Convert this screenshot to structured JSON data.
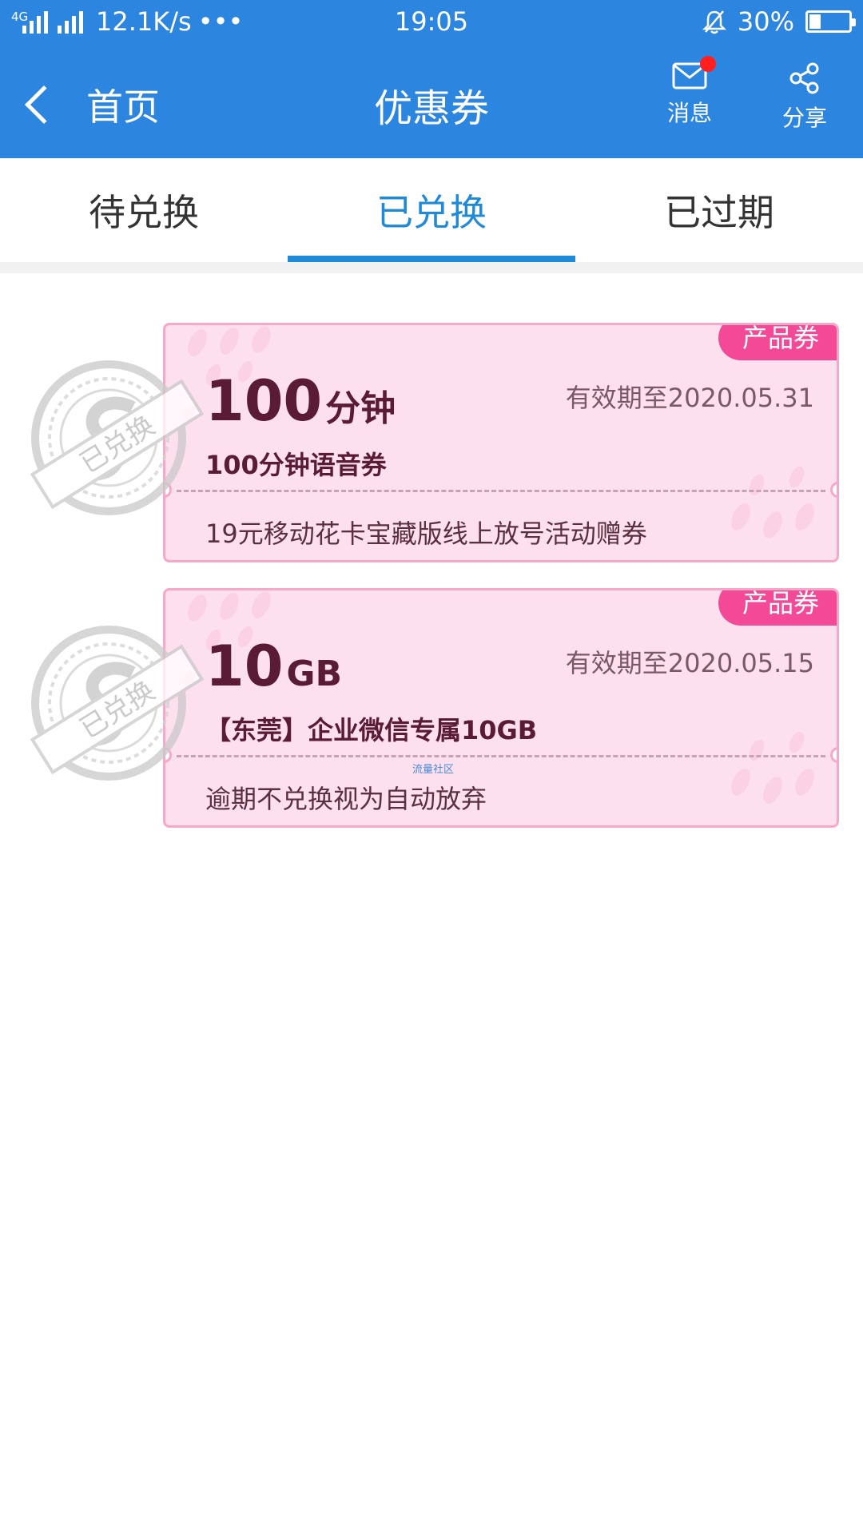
{
  "status_bar": {
    "network": "4G",
    "speed": "12.1K/s",
    "more": "•••",
    "time": "19:05",
    "battery": "30%",
    "battery_level": 0.3
  },
  "header": {
    "back_label": "首页",
    "title": "优惠券",
    "messages_label": "消息",
    "share_label": "分享"
  },
  "tabs": [
    {
      "label": "待兑换",
      "active": false
    },
    {
      "label": "已兑换",
      "active": true
    },
    {
      "label": "已过期",
      "active": false
    }
  ],
  "coupons": [
    {
      "tag": "产品券",
      "amount": "100",
      "unit": "分钟",
      "validity": "有效期至2020.05.31",
      "name": "100分钟语音券",
      "description": "19元移动花卡宝藏版线上放号活动赠券",
      "stamp": "已兑换"
    },
    {
      "tag": "产品券",
      "amount": "10",
      "unit": "GB",
      "validity": "有效期至2020.05.15",
      "name": "【东莞】企业微信专属10GB",
      "description": "逾期不兑换视为自动放弃",
      "stamp": "已兑换"
    }
  ],
  "watermark": "流量社区",
  "colors": {
    "header_bg": "#2c86e0",
    "tab_active": "#1f8ad8",
    "coupon_bg": "#fde0ee",
    "coupon_border": "#f7a8c9",
    "tag_bg": "#f34997",
    "coupon_text": "#5a1b35"
  }
}
